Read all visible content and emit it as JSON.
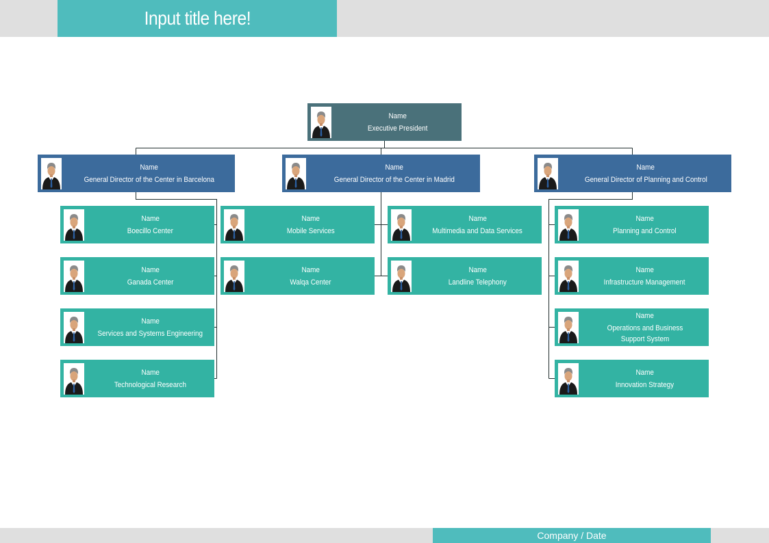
{
  "header": {
    "title": "Input title here!"
  },
  "footer": {
    "text": "Company / Date"
  },
  "colors": {
    "accent": "#4fbcbd",
    "bar_gray": "#dfdfdf",
    "executive": "#4a717a",
    "director": "#3c6b9c",
    "unit": "#33b3a3",
    "connector": "#1f2d2d"
  },
  "icons": {
    "person": "person-avatar-icon"
  },
  "org": {
    "executive": {
      "name": "Name",
      "role": "Executive President"
    },
    "directors": [
      {
        "name": "Name",
        "role": "General Director of the Center in Barcelona",
        "units": [
          {
            "name": "Name",
            "role": "Boecillo Center"
          },
          {
            "name": "Name",
            "role": "Ganada Center"
          },
          {
            "name": "Name",
            "role": "Services and Systems Engineering"
          },
          {
            "name": "Name",
            "role": "Technological Research"
          }
        ]
      },
      {
        "name": "Name",
        "role": "General Director of the Center in Madrid",
        "units": [
          {
            "name": "Name",
            "role": "Mobile Services"
          },
          {
            "name": "Name",
            "role": "Walqa Center"
          },
          {
            "name": "Name",
            "role": "Multimedia and Data Services"
          },
          {
            "name": "Name",
            "role": "Landline Telephony"
          }
        ]
      },
      {
        "name": "Name",
        "role": "General Director of Planning and Control",
        "units": [
          {
            "name": "Name",
            "role": "Planning and Control"
          },
          {
            "name": "Name",
            "role": "Infrastructure Management"
          },
          {
            "name": "Name",
            "role": "Operations and Business Support System"
          },
          {
            "name": "Name",
            "role": "Innovation Strategy"
          }
        ]
      }
    ]
  }
}
